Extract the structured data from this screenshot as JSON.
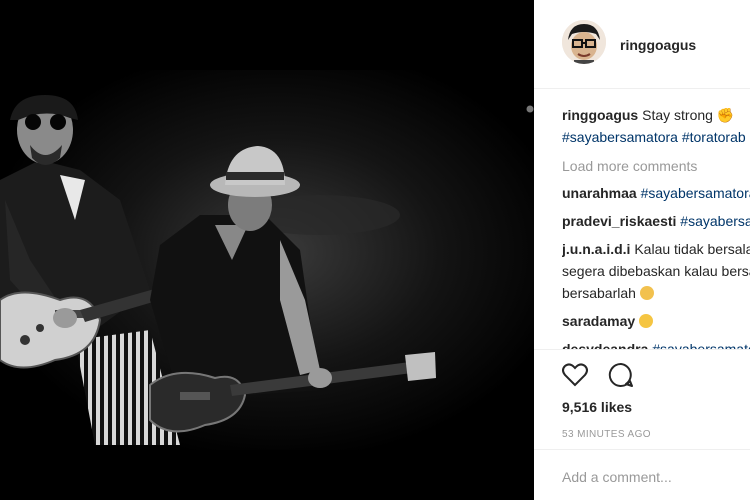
{
  "post": {
    "username": "ringgoagus",
    "caption_user": "ringgoagus",
    "caption_text": "Stay strong",
    "caption_tags": "#sayabersamatora #toratorab"
  },
  "load_more": "Load more comments",
  "comments": [
    {
      "user": "unarahmaa",
      "text": "#sayabersamatora"
    },
    {
      "user": "pradevi_riskaesti",
      "text": "#sayabersamatora"
    },
    {
      "user": "j.u.n.a.i.d.i",
      "text": "Kalau tidak bersalah",
      "text2": "segera dibebaskan kalau bersalah",
      "text3": "bersabarlah"
    },
    {
      "user": "saradamay",
      "text": ""
    },
    {
      "user": "desydeandra",
      "text": "#sayabersamatora"
    }
  ],
  "likes": "9,516 likes",
  "time": "53 MINUTES AGO",
  "add_comment_placeholder": "Add a comment...",
  "icons": {
    "like": "heart-icon",
    "comment": "comment-icon"
  }
}
